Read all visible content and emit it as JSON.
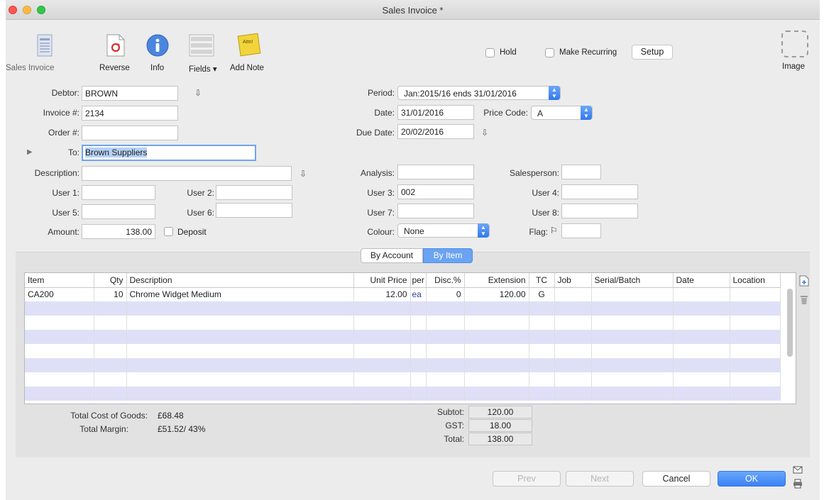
{
  "window": {
    "title": "Sales Invoice *"
  },
  "toolbar": {
    "sales_invoice": "Sales Invoice",
    "reverse": "Reverse",
    "info": "Info",
    "fields": "Fields ▾",
    "add_note": "Add Note",
    "note_text": "Attn!",
    "hold": "Hold",
    "make_recurring": "Make Recurring",
    "setup": "Setup",
    "image": "Image"
  },
  "form": {
    "debtor_label": "Debtor:",
    "debtor": "BROWN",
    "invoice_label": "Invoice #:",
    "invoice": "2134",
    "order_label": "Order #:",
    "order": "",
    "to_label": "To:",
    "to": "Brown Suppliers",
    "description_label": "Description:",
    "description": "",
    "user1_label": "User 1:",
    "user1": "",
    "user2_label": "User 2:",
    "user2": "",
    "user5_label": "User 5:",
    "user5": "",
    "user6_label": "User 6:",
    "user6": "",
    "amount_label": "Amount:",
    "amount": "138.00",
    "deposit_label": "Deposit",
    "period_label": "Period:",
    "period": "Jan:2015/16 ends 31/01/2016",
    "date_label": "Date:",
    "date": "31/01/2016",
    "price_code_label": "Price Code:",
    "price_code": "A",
    "due_date_label": "Due Date:",
    "due_date": "20/02/2016",
    "analysis_label": "Analysis:",
    "analysis": "",
    "salesperson_label": "Salesperson:",
    "salesperson": "",
    "user3_label": "User 3:",
    "user3": "002",
    "user4_label": "User 4:",
    "user4": "",
    "user7_label": "User 7:",
    "user7": "",
    "user8_label": "User 8:",
    "user8": "",
    "colour_label": "Colour:",
    "colour": "None",
    "flag_label": "Flag:",
    "flag": ""
  },
  "tabs": {
    "by_account": "By Account",
    "by_item": "By Item"
  },
  "grid": {
    "columns": [
      "Item",
      "Qty",
      "Description",
      "Unit Price",
      "per",
      "Disc.%",
      "Extension",
      "TC",
      "Job",
      "Serial/Batch",
      "Date",
      "Location"
    ],
    "rows": [
      [
        "CA200",
        "10",
        "Chrome Widget Medium",
        "12.00",
        "ea",
        "0",
        "120.00",
        "G",
        "",
        "",
        "",
        ""
      ]
    ]
  },
  "totals": {
    "cost_label": "Total Cost of Goods:",
    "cost": "£68.48",
    "margin_label": "Total Margin:",
    "margin": "£51.52/ 43%",
    "subtot_label": "Subtot:",
    "subtot": "120.00",
    "gst_label": "GST:",
    "gst": "18.00",
    "total_label": "Total:",
    "total": "138.00"
  },
  "footer": {
    "prev": "Prev",
    "next": "Next",
    "cancel": "Cancel",
    "ok": "OK"
  },
  "colors": {
    "accent": "#3b82f6",
    "stripe": "#dfe0f7"
  }
}
